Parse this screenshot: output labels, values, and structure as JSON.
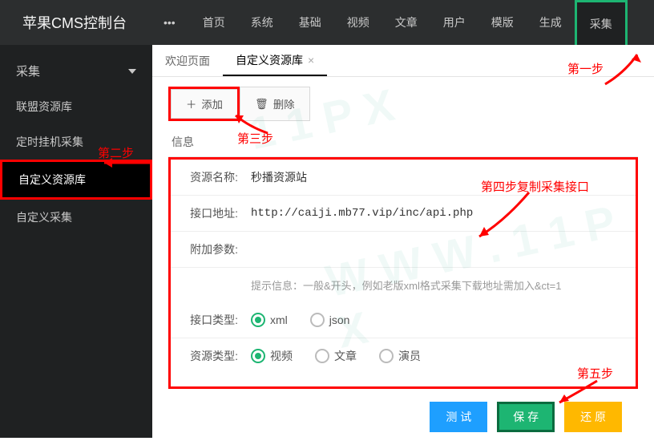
{
  "brand": "苹果CMS控制台",
  "topnav": {
    "items": [
      "首页",
      "系统",
      "基础",
      "视频",
      "文章",
      "用户",
      "模版",
      "生成",
      "采集"
    ],
    "activeIndex": 8
  },
  "sidebar": {
    "header": "采集",
    "items": [
      "联盟资源库",
      "定时挂机采集",
      "自定义资源库",
      "自定义采集"
    ],
    "activeIndex": 2
  },
  "tabs": {
    "items": [
      {
        "label": "欢迎页面",
        "closable": false
      },
      {
        "label": "自定义资源库",
        "closable": true
      }
    ],
    "activeIndex": 1
  },
  "toolbar": {
    "add_label": "添加",
    "delete_label": "删除"
  },
  "section_label": "信息",
  "form": {
    "name_label": "资源名称:",
    "name_value": "秒播资源站",
    "url_label": "接口地址:",
    "url_value": "http://caiji.mb77.vip/inc/api.php",
    "extra_label": "附加参数:",
    "extra_value": "",
    "hint": "提示信息：一般&开头，例如老版xml格式采集下载地址需加入&ct=1",
    "api_type_label": "接口类型:",
    "api_type_options": [
      "xml",
      "json"
    ],
    "api_type_selected": 0,
    "res_type_label": "资源类型:",
    "res_type_options": [
      "视频",
      "文章",
      "演员"
    ],
    "res_type_selected": 0
  },
  "actions": {
    "test": "测 试",
    "save": "保 存",
    "reset": "还 原"
  },
  "annotations": {
    "step1": "第一步",
    "step2": "第二步",
    "step3": "第三步",
    "step4": "第四步复制采集接口",
    "step5": "第五步"
  }
}
